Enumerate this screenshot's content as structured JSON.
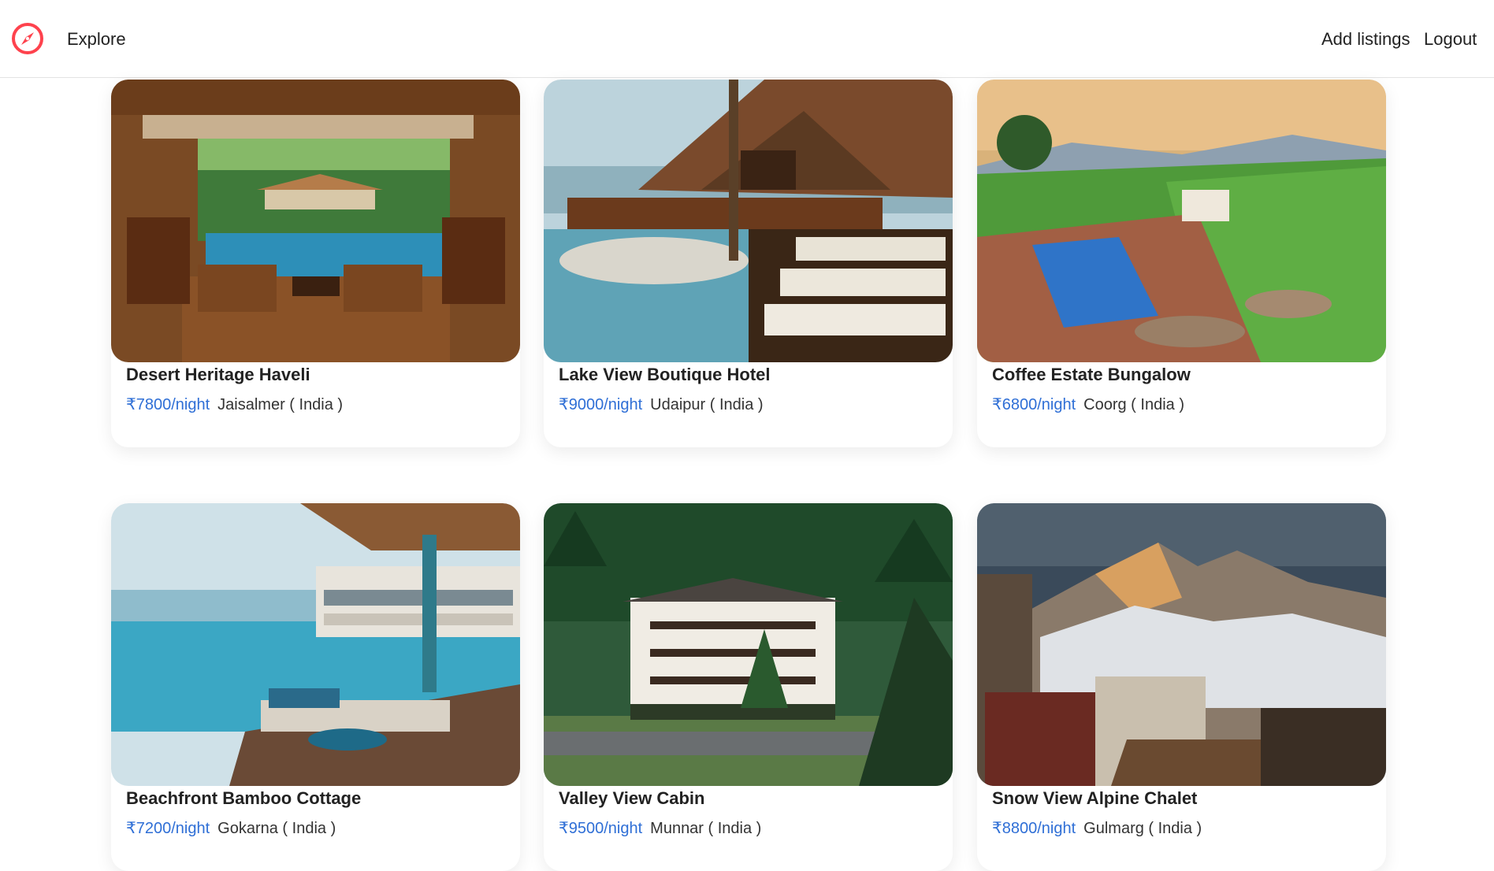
{
  "nav": {
    "logo_icon": "compass-icon",
    "explore_label": "Explore",
    "add_listings_label": "Add listings",
    "logout_label": "Logout",
    "brand_color": "#fe424d"
  },
  "listings": [
    {
      "title": "Desert Heritage Haveli",
      "price": "₹7800/night",
      "location": "Jaisalmer ( India )"
    },
    {
      "title": "Lake View Boutique Hotel",
      "price": "₹9000/night",
      "location": "Udaipur ( India )"
    },
    {
      "title": "Coffee Estate Bungalow",
      "price": "₹6800/night",
      "location": "Coorg ( India )"
    },
    {
      "title": "Beachfront Bamboo Cottage",
      "price": "₹7200/night",
      "location": "Gokarna ( India )"
    },
    {
      "title": "Valley View Cabin",
      "price": "₹9500/night",
      "location": "Munnar ( India )"
    },
    {
      "title": "Snow View Alpine Chalet",
      "price": "₹8800/night",
      "location": "Gulmarg ( India )"
    }
  ],
  "colors": {
    "price": "#2f6fd6"
  }
}
